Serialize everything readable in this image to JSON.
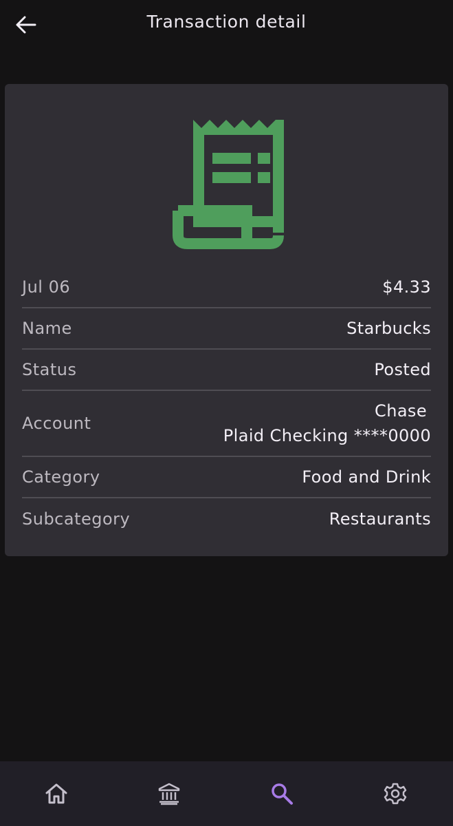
{
  "header": {
    "title": "Transaction detail",
    "back_icon": "arrow-left-icon"
  },
  "transaction": {
    "icon": "receipt-icon",
    "icon_color": "#4f9e5c",
    "rows": [
      {
        "label": "Jul 06",
        "value": "$4.33"
      },
      {
        "label": "Name",
        "value": "Starbucks"
      },
      {
        "label": "Status",
        "value": "Posted"
      },
      {
        "label": "Account",
        "value_line1": "Chase",
        "value_line2": "Plaid Checking ****0000"
      },
      {
        "label": "Category",
        "value": "Food and Drink"
      },
      {
        "label": "Subcategory",
        "value": "Restaurants"
      }
    ]
  },
  "bottom_nav": {
    "items": [
      {
        "icon": "home-icon",
        "active": false
      },
      {
        "icon": "bank-icon",
        "active": false
      },
      {
        "icon": "search-icon",
        "active": true
      },
      {
        "icon": "gear-icon",
        "active": false
      }
    ],
    "active_color": "#a77be6",
    "inactive_color": "#c4bfcb"
  }
}
